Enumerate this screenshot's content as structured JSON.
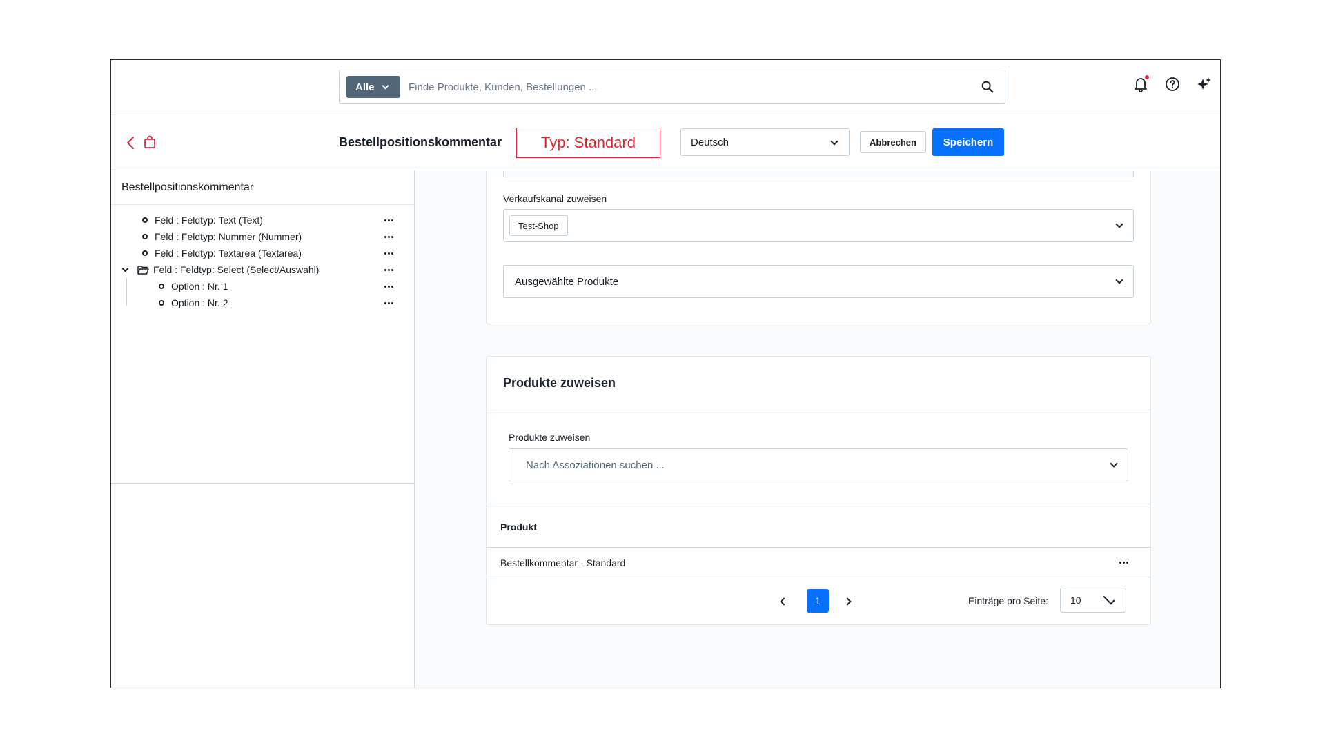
{
  "search": {
    "type_label": "Alle",
    "placeholder": "Finde Produkte, Kunden, Bestellungen ..."
  },
  "header": {
    "title": "Bestellpositionskommentar",
    "type_badge": "Typ: Standard",
    "language": "Deutsch",
    "cancel_label": "Abbrechen",
    "save_label": "Speichern"
  },
  "sidebar": {
    "title": "Bestellpositionskommentar",
    "items": [
      {
        "label": "Feld : Feldtyp: Text (Text)"
      },
      {
        "label": "Feld : Feldtyp: Nummer (Nummer)"
      },
      {
        "label": "Feld : Feldtyp: Textarea (Textarea)"
      },
      {
        "label": "Feld : Feldtyp: Select (Select/Auswahl)"
      },
      {
        "label": "Option : Nr. 1"
      },
      {
        "label": "Option : Nr. 2"
      }
    ]
  },
  "assignment": {
    "sales_channel_label": "Verkaufskanal zuweisen",
    "sales_channel_tag": "Test-Shop",
    "selected_products": "Ausgewählte Produkte"
  },
  "products_card": {
    "title": "Produkte zuweisen",
    "field_label": "Produkte zuweisen",
    "search_placeholder": "Nach Assoziationen suchen ...",
    "column_header": "Produkt",
    "rows": [
      {
        "name": "Bestellkommentar - Standard"
      }
    ],
    "current_page": "1",
    "per_page_label": "Einträge pro Seite:",
    "per_page_value": "10"
  },
  "colors": {
    "accent": "#0870ff",
    "highlight_border": "#e0262f",
    "notification_dot": "#de294c",
    "type_button": "#52667a"
  }
}
